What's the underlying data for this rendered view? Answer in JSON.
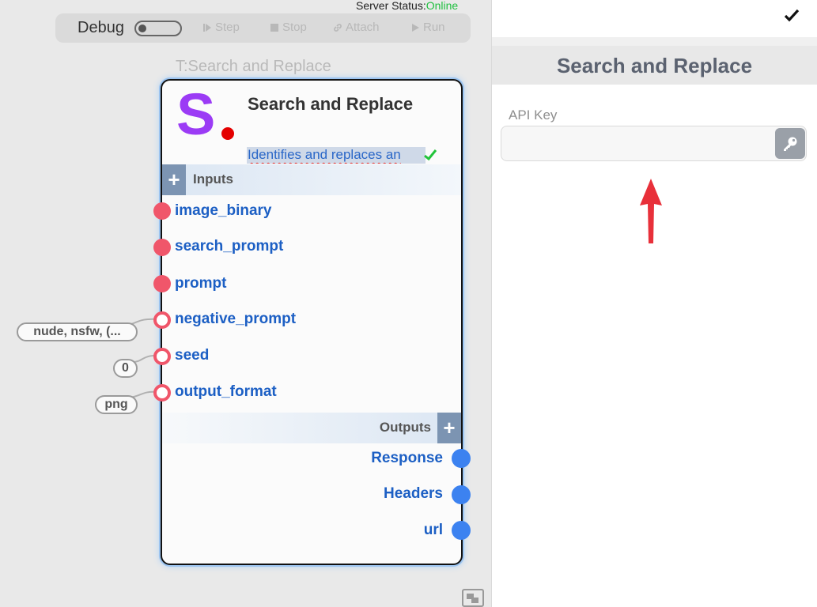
{
  "server_status": {
    "label": "Server Status:",
    "value": "Online",
    "value_color": "#1fbf3f"
  },
  "toolbar": {
    "debug_label": "Debug",
    "debug_enabled": false,
    "buttons": [
      {
        "label": "Step",
        "icon": "step-icon"
      },
      {
        "label": "Stop",
        "icon": "stop-icon"
      },
      {
        "label": "Attach",
        "icon": "link-icon"
      },
      {
        "label": "Run",
        "icon": "play-icon"
      }
    ]
  },
  "node": {
    "type_label": "T:Search and Replace",
    "logo_letter": "S",
    "title": "Search and Replace",
    "description": "Identifies and replaces an",
    "inputs_label": "Inputs",
    "inputs": [
      {
        "name": "image_binary",
        "required": true
      },
      {
        "name": "search_prompt",
        "required": true
      },
      {
        "name": "prompt",
        "required": true
      },
      {
        "name": "negative_prompt",
        "required": false,
        "value": "nude, nsfw, (..."
      },
      {
        "name": "seed",
        "required": false,
        "value": "0"
      },
      {
        "name": "output_format",
        "required": false,
        "value": "png"
      }
    ],
    "outputs_label": "Outputs",
    "outputs": [
      {
        "name": "Response"
      },
      {
        "name": "Headers"
      },
      {
        "name": "url"
      }
    ]
  },
  "panel": {
    "title": "Search and Replace",
    "api_key_label": "API Key",
    "api_key_value": ""
  },
  "colors": {
    "accent_purple": "#9b3bf5",
    "port_required": "#f0566a",
    "port_output": "#3c82f0",
    "link_blue": "#1c5fc4",
    "annotation_arrow": "#e8303a"
  }
}
